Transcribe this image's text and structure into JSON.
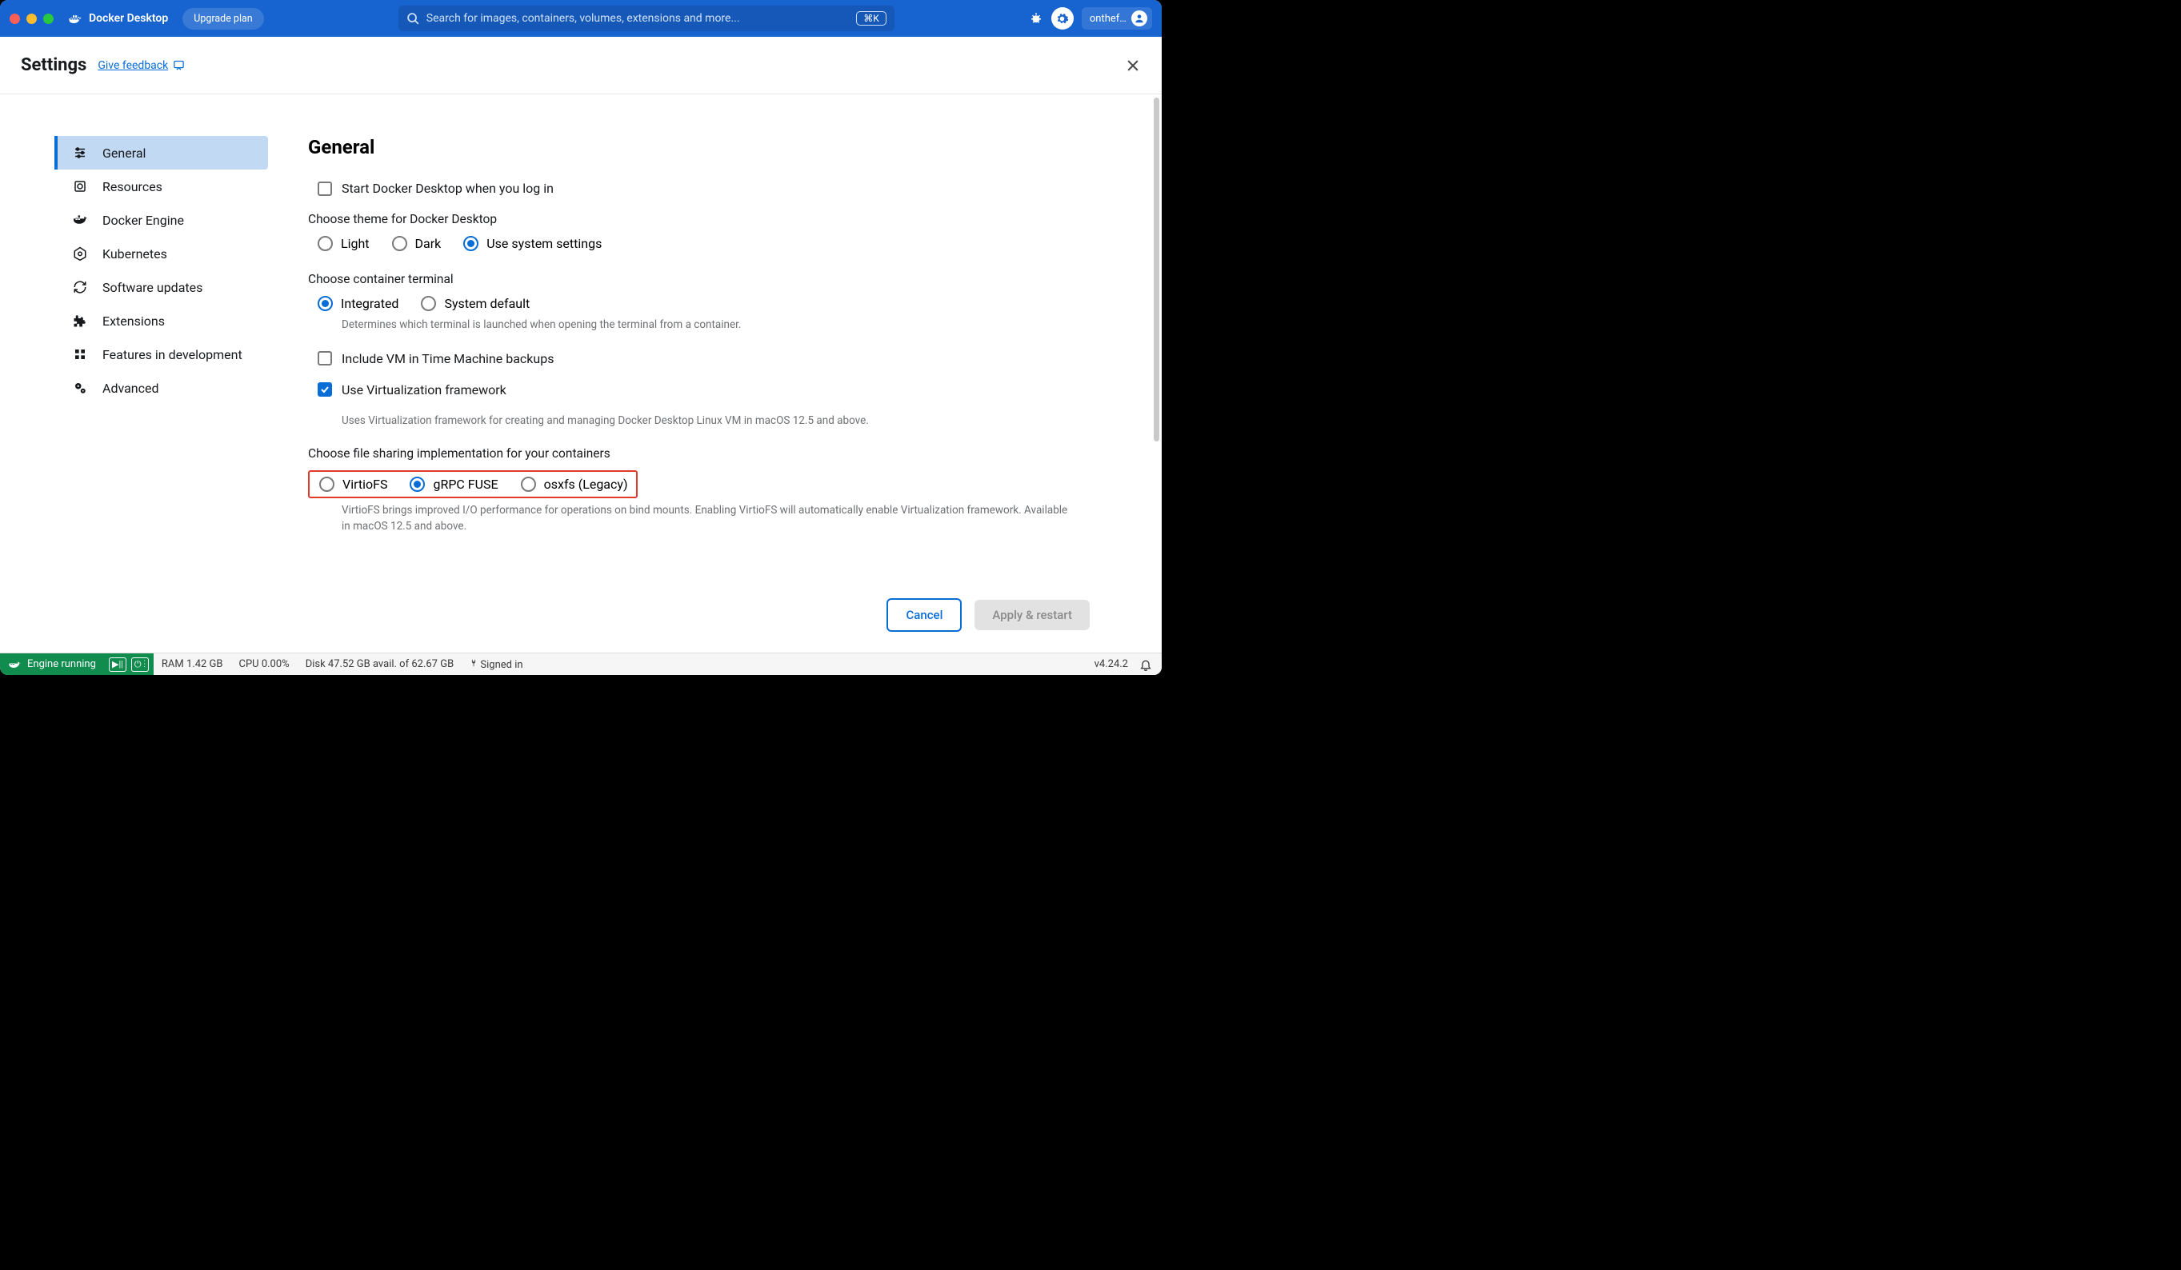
{
  "titlebar": {
    "app_name": "Docker Desktop",
    "upgrade_label": "Upgrade plan",
    "search_placeholder": "Search for images, containers, volumes, extensions and more...",
    "kbd_hint": "⌘K",
    "username": "onthef…"
  },
  "settings_header": {
    "title": "Settings",
    "feedback_label": "Give feedback"
  },
  "sidebar": {
    "items": [
      {
        "label": "General"
      },
      {
        "label": "Resources"
      },
      {
        "label": "Docker Engine"
      },
      {
        "label": "Kubernetes"
      },
      {
        "label": "Software updates"
      },
      {
        "label": "Extensions"
      },
      {
        "label": "Features in development"
      },
      {
        "label": "Advanced"
      }
    ]
  },
  "content": {
    "heading": "General",
    "start_login_label": "Start Docker Desktop when you log in",
    "theme_group": "Choose theme for Docker Desktop",
    "theme_options": {
      "light": "Light",
      "dark": "Dark",
      "system": "Use system settings"
    },
    "terminal_group": "Choose container terminal",
    "terminal_options": {
      "integrated": "Integrated",
      "system": "System default"
    },
    "terminal_help": "Determines which terminal is launched when opening the terminal from a container.",
    "timemachine_label": "Include VM in Time Machine backups",
    "virt_label": "Use Virtualization framework",
    "virt_help": "Uses Virtualization framework for creating and managing Docker Desktop Linux VM in macOS 12.5 and above.",
    "fs_group": "Choose file sharing implementation for your containers",
    "fs_options": {
      "virtiofs": "VirtioFS",
      "grpc": "gRPC FUSE",
      "osxfs": "osxfs (Legacy)"
    },
    "fs_help": "VirtioFS brings improved I/O performance for operations on bind mounts. Enabling VirtioFS will automatically enable Virtualization framework. Available in macOS 12.5 and above."
  },
  "footer": {
    "cancel": "Cancel",
    "apply": "Apply & restart"
  },
  "status": {
    "engine": "Engine running",
    "ram": "RAM 1.42 GB",
    "cpu": "CPU 0.00%",
    "disk": "Disk 47.52 GB avail. of 62.67 GB",
    "signed": "Signed in",
    "version": "v4.24.2"
  }
}
